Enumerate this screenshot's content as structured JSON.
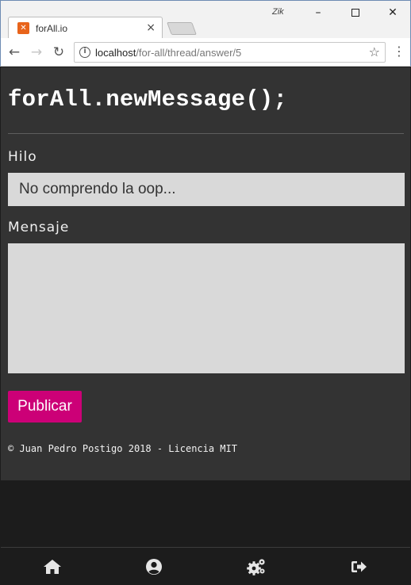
{
  "browser": {
    "tab_title": "forAll.io",
    "tab_favicon_letter": "✕",
    "profile_badge": "Zik",
    "url_host": "localhost",
    "url_path": "/for-all/thread/answer/5"
  },
  "page": {
    "title": "forAll.newMessage();",
    "thread_label": "Hilo",
    "thread_value": "No comprendo la oop...",
    "message_label": "Mensaje",
    "message_value": "",
    "publish_label": "Publicar",
    "footer": "© Juan Pedro Postigo 2018 - Licencia MIT"
  },
  "bottom_nav": {
    "items": [
      {
        "icon": "home-icon"
      },
      {
        "icon": "user-icon"
      },
      {
        "icon": "settings-icon"
      },
      {
        "icon": "logout-icon"
      }
    ]
  },
  "colors": {
    "page_bg": "#333333",
    "input_bg": "#d9d9d9",
    "accent": "#cc0077",
    "nav_bg": "#1c1c1c"
  }
}
